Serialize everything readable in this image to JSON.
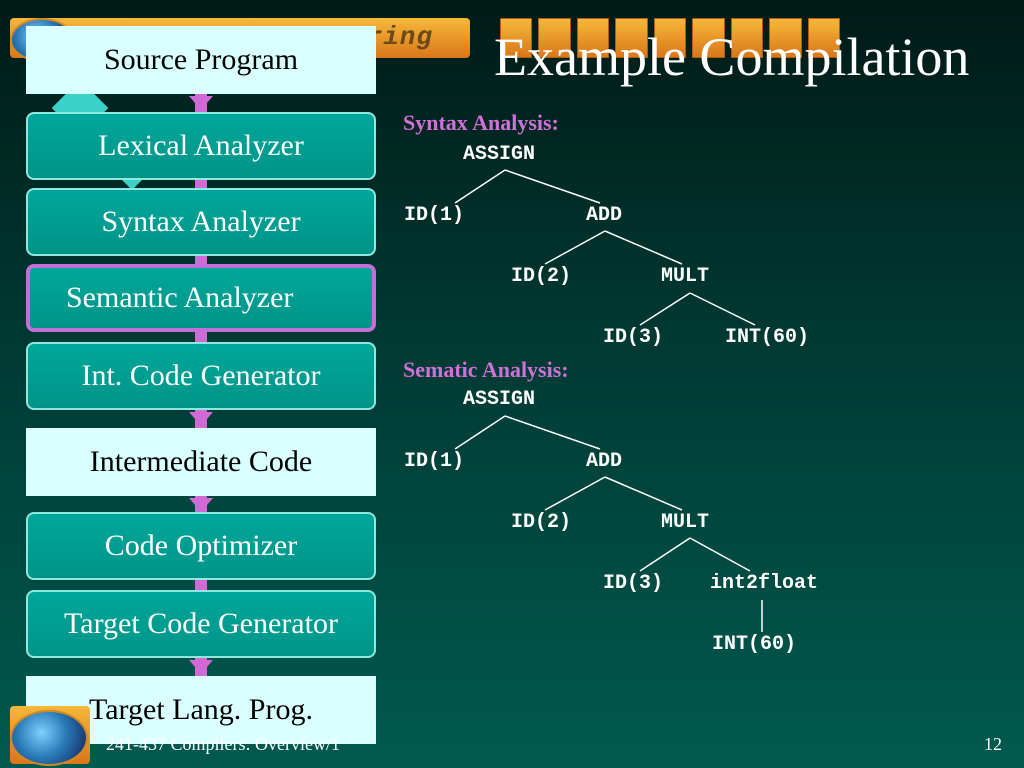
{
  "header": {
    "banner_word": "ering",
    "title": "Example Compilation"
  },
  "pipeline": {
    "stages": [
      {
        "label": "Source Program"
      },
      {
        "label": "Lexical Analyzer"
      },
      {
        "label": "Syntax Analyzer"
      },
      {
        "label": "Semantic Analyzer"
      },
      {
        "label": "Int. Code Generator"
      },
      {
        "label": "Intermediate Code"
      },
      {
        "label": "Code Optimizer"
      },
      {
        "label": "Target Code Generator"
      },
      {
        "label": "Target Lang. Prog."
      }
    ]
  },
  "syntax": {
    "label": "Syntax Analysis:",
    "nodes": [
      "ASSIGN",
      "ID(1)",
      "ADD",
      "ID(2)",
      "MULT",
      "ID(3)",
      "INT(60)"
    ]
  },
  "semantic": {
    "label": "Sematic Analysis:",
    "nodes": [
      "ASSIGN",
      "ID(1)",
      "ADD",
      "ID(2)",
      "MULT",
      "ID(3)",
      "int2float",
      "INT(60)"
    ]
  },
  "footer": {
    "course": "241-437 Compilers: Overview/1",
    "page": "12"
  },
  "colors": {
    "accent": "#d06bd6",
    "box_teal": "#00a79a",
    "box_light": "#d9ffff"
  }
}
